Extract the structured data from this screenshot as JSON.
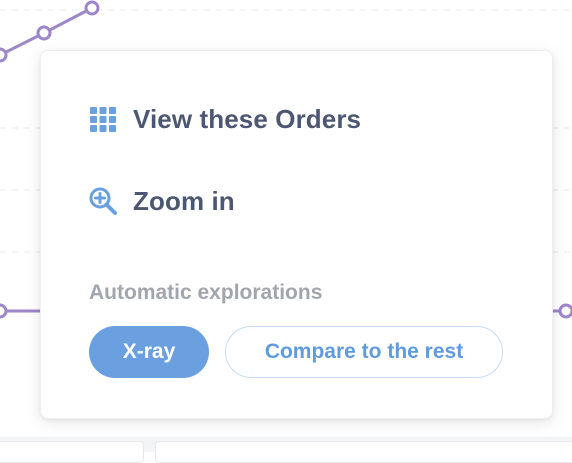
{
  "background": {
    "line_color": "#9d86c9",
    "grid_color": "#e8e9ec"
  },
  "popover": {
    "actions": [
      {
        "label": "View these Orders",
        "icon": "grid-icon"
      },
      {
        "label": "Zoom in",
        "icon": "zoom-in-icon"
      }
    ],
    "section_title": "Automatic explorations",
    "buttons": {
      "xray": "X-ray",
      "compare": "Compare to the rest"
    },
    "colors": {
      "accent": "#6aa0e0",
      "text": "#4c5773",
      "muted": "#a1a5ad"
    }
  }
}
